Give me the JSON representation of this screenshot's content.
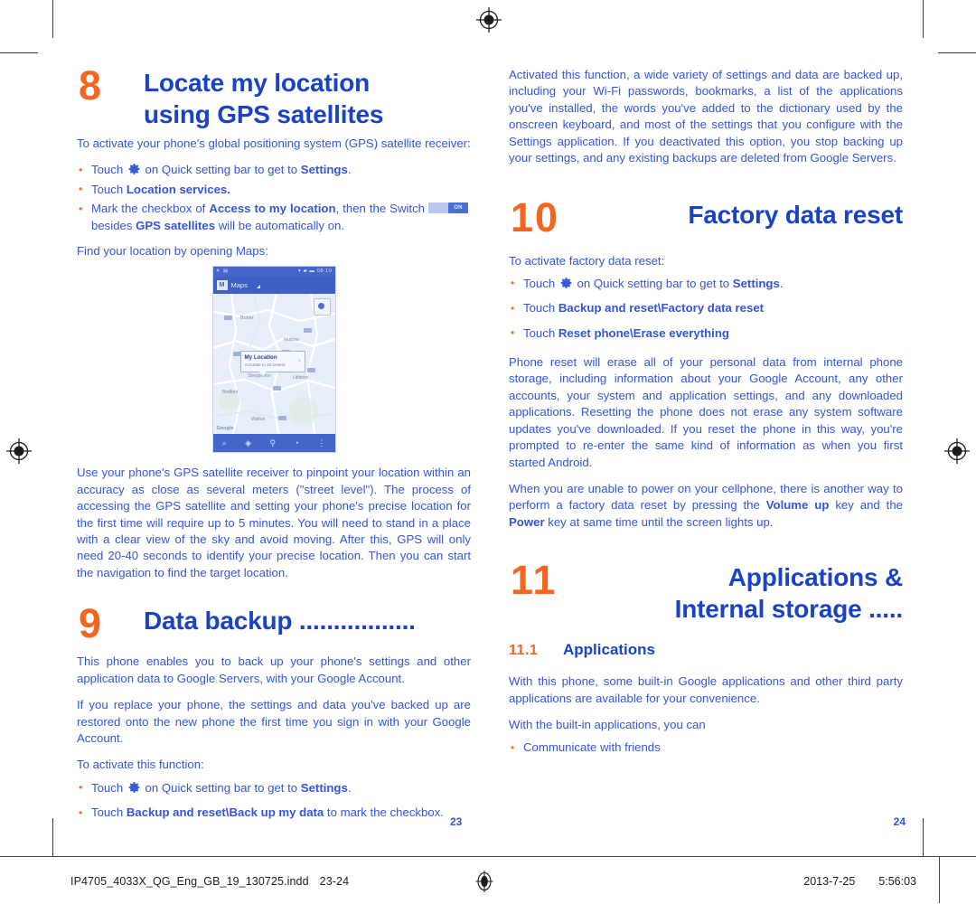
{
  "colors": {
    "orange": "#f4661f",
    "blue_heading": "#1943c4",
    "blue_body": "#3355dd",
    "page_number": "#2f57d8"
  },
  "left_column": {
    "chapter": {
      "number": "8",
      "title_line1": "Locate my location",
      "title_line2": "using GPS satellites"
    },
    "intro": "To activate your phone's global positioning system (GPS) satellite receiver:",
    "bullets": [
      {
        "pre": "Touch ",
        "icon": "gear-icon",
        "mid": " on Quick setting bar to get to ",
        "bold": "Settings",
        "post": "."
      },
      {
        "pre": "Touch ",
        "bold": "Location services.",
        "post": ""
      },
      {
        "pre": "Mark the checkbox of ",
        "bold": "Access to my location",
        "post": ", then the Switch ",
        "switch_label": "ON",
        "post2": " besides ",
        "bold2": "GPS satellites",
        "post3": " will be automatically on."
      }
    ],
    "find_location": "Find your location by opening Maps:",
    "phone_screenshot": {
      "status_left": "☀ ▤",
      "status_right": "▾ ▰ ▬ 08:10",
      "app_logo": "M",
      "app_name": "Maps",
      "bubble_title": "My Location",
      "bubble_sub": "Accurate to 20 meters",
      "bubble_arrow": "›",
      "map_attribution": "Google",
      "nav_icons": [
        "⌕",
        "◈",
        "⚲",
        "◔",
        "⋮"
      ]
    },
    "paragraph_gps": "Use your phone's GPS satellite receiver to pinpoint your location within an accuracy as close as several meters (\"street level\"). The process of accessing the GPS satellite and setting your phone's precise location for the first time will require up to 5 minutes. You will need to stand in a place with a clear view of the sky and avoid moving. After this, GPS will only need 20-40 seconds to identify your precise location. Then you can start the navigation to find the target location.",
    "chapter9": {
      "number": "9",
      "title": "Data backup ................."
    },
    "paragraph_backup_1": "This phone enables you to back up your phone's settings and other application data to Google Servers, with your Google Account.",
    "paragraph_backup_2": "If you replace your phone, the settings and data you've backed up are restored onto the new phone the first time you sign in with your Google Account.",
    "activate_label": "To activate this function:",
    "backup_bullets": [
      {
        "pre": "Touch ",
        "icon": "gear-icon",
        "mid": " on Quick setting bar to get to ",
        "bold": "Settings",
        "post": "."
      },
      {
        "pre": "Touch ",
        "bold": "Backup and reset\\Back up my data",
        "post": " to mark the checkbox."
      }
    ],
    "page_number": "23"
  },
  "right_column": {
    "paragraph_activated": "Activated this function, a wide variety of settings and data are backed up, including your Wi-Fi passwords, bookmarks, a list of the applications you've installed, the words you've added to the dictionary used by the onscreen keyboard, and most of the settings that you configure with the Settings application. If you deactivated this option, you stop backing up your settings, and any existing backups are deleted from Google Servers.",
    "chapter10": {
      "number": "10",
      "title": "Factory data reset"
    },
    "reset_intro": "To activate factory data reset:",
    "reset_bullets": [
      {
        "pre": "Touch ",
        "icon": "gear-icon",
        "mid": " on Quick setting bar to get to ",
        "bold": "Settings",
        "post": "."
      },
      {
        "pre": "Touch ",
        "bold": "Backup and reset\\Factory data reset",
        "post": ""
      },
      {
        "pre": "Touch ",
        "bold": "Reset phone\\Erase everything",
        "post": ""
      }
    ],
    "paragraph_reset_1": "Phone reset will erase all of your personal data from internal phone storage, including information about your Google Account, any other accounts, your system and application settings, and any downloaded applications. Resetting the phone does not erase any system software updates you've downloaded. If you reset the phone in this way, you're prompted to re-enter the same kind of information as when you first started Android.",
    "paragraph_reset_2": {
      "pre": "When you are unable to power on your cellphone, there is another way to perform a factory data reset by pressing the ",
      "bold1": "Volume up",
      "mid": " key and the ",
      "bold2": "Power",
      "post": " key at same time until the screen lights up."
    },
    "chapter11": {
      "number": "11",
      "title_line1": "Applications &",
      "title_line2": "Internal storage ....."
    },
    "subsection": {
      "number": "11.1",
      "title": "Applications"
    },
    "paragraph_apps_1": "With this phone, some built-in Google applications and other third party applications are available for your convenience.",
    "paragraph_apps_2": "With the built-in applications, you can",
    "apps_bullets": [
      {
        "pre": "Communicate with friends",
        "bold": "",
        "post": ""
      }
    ],
    "page_number": "24"
  },
  "footer": {
    "filename": "IP4705_4033X_QG_Eng_GB_19_130725.indd",
    "pages": "23-24",
    "date": "2013-7-25",
    "time": "5:56:03"
  }
}
